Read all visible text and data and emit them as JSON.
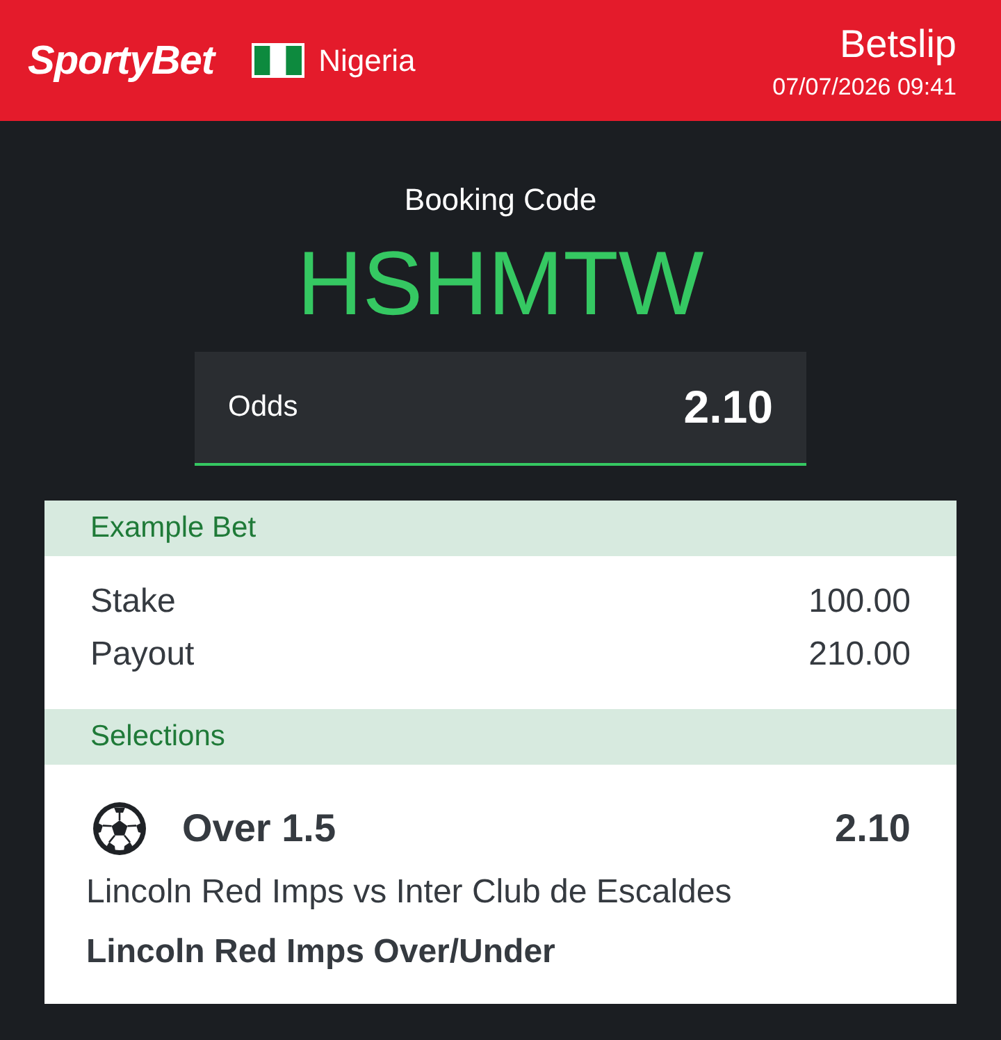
{
  "header": {
    "logo": "SportyBet",
    "country": "Nigeria",
    "title": "Betslip",
    "datetime": "07/07/2026 09:41"
  },
  "booking": {
    "label": "Booking Code",
    "code": "HSHMTW"
  },
  "odds": {
    "label": "Odds",
    "value": "2.10"
  },
  "sections": [
    {
      "kind": "summary",
      "title": "Example Bet",
      "rows": [
        {
          "label": "Stake",
          "value": "100.00"
        },
        {
          "label": "Payout",
          "value": "210.00"
        }
      ]
    },
    {
      "kind": "selections",
      "title": "Selections",
      "items": [
        {
          "pick": "Over 1.5",
          "odds": "2.10",
          "match": "Lincoln Red Imps vs Inter Club de Escaldes",
          "market": "Lincoln Red Imps Over/Under"
        }
      ]
    }
  ]
}
